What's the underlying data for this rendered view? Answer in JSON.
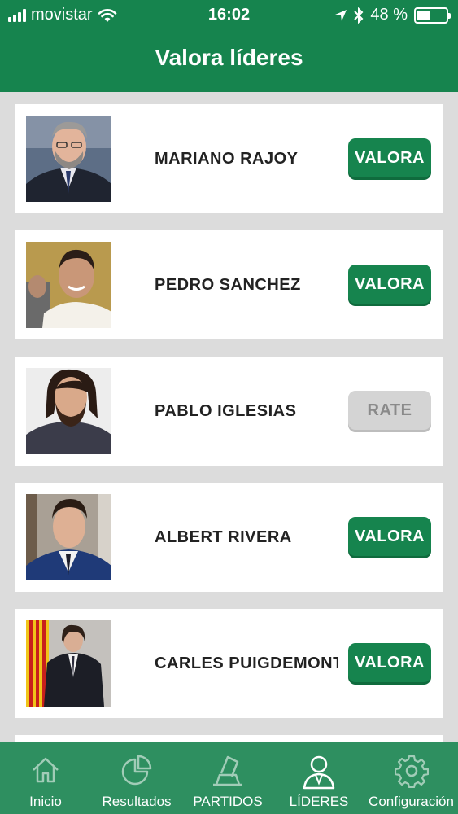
{
  "status_bar": {
    "carrier": "movistar",
    "time": "16:02",
    "battery": "48 %",
    "battery_level": 0.48
  },
  "header": {
    "title": "Valora líderes"
  },
  "leaders": [
    {
      "name": "MARIANO RAJOY",
      "button": "VALORA",
      "button_state": "active"
    },
    {
      "name": "PEDRO SANCHEZ",
      "button": "VALORA",
      "button_state": "active"
    },
    {
      "name": "PABLO IGLESIAS",
      "button": "RATE",
      "button_state": "disabled"
    },
    {
      "name": "ALBERT RIVERA",
      "button": "VALORA",
      "button_state": "active"
    },
    {
      "name": "CARLES PUIGDEMONT",
      "button": "VALORA",
      "button_state": "active"
    }
  ],
  "tabbar": {
    "items": [
      {
        "label": "Inicio",
        "icon": "home-icon"
      },
      {
        "label": "Resultados",
        "icon": "pie-chart-icon"
      },
      {
        "label": "PARTIDOS",
        "icon": "ballot-icon"
      },
      {
        "label": "LÍDERES",
        "icon": "person-icon",
        "active": true
      },
      {
        "label": "Configuración",
        "icon": "gear-icon"
      }
    ]
  },
  "colors": {
    "primary": "#16844e",
    "tabbar": "#2e8f60",
    "disabled": "#d4d4d4"
  }
}
